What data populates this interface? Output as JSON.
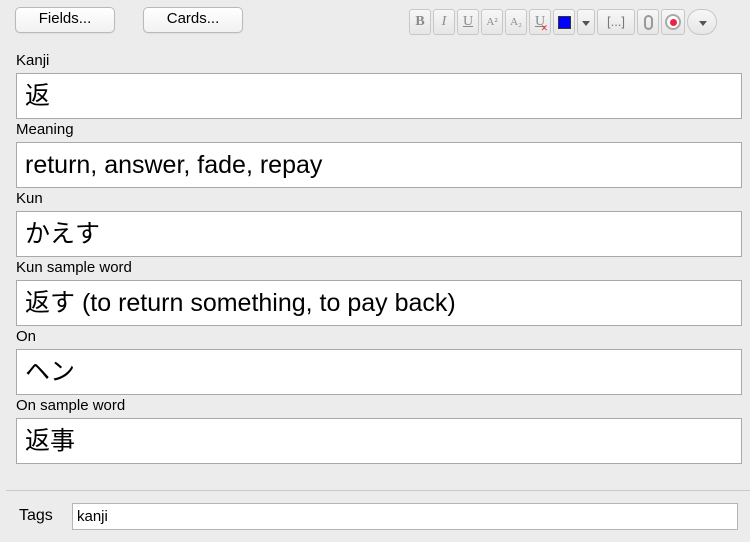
{
  "header": {
    "fields_button": "Fields...",
    "cards_button": "Cards..."
  },
  "toolbar": {
    "bold": "B",
    "italic": "I",
    "underline": "U",
    "superscript": "A²",
    "subscript": "A₂",
    "clear_format": "U",
    "text_color": "#0000ff",
    "cloze": "[...]",
    "icons": [
      "bold-icon",
      "italic-icon",
      "underline-icon",
      "superscript-icon",
      "subscript-icon",
      "clear-format-icon",
      "text-color-icon",
      "color-dropdown-icon",
      "cloze-icon",
      "attach-icon",
      "record-icon",
      "more-options-icon"
    ]
  },
  "fields": [
    {
      "label": "Kanji",
      "value": "返"
    },
    {
      "label": "Meaning",
      "value": "return, answer, fade, repay"
    },
    {
      "label": "Kun",
      "value": "かえす"
    },
    {
      "label": "Kun sample word",
      "value": "返す (to return something, to pay back)"
    },
    {
      "label": "On",
      "value": "ヘン"
    },
    {
      "label": "On sample word",
      "value": "返事"
    }
  ],
  "tags": {
    "label": "Tags",
    "value": "kanji"
  }
}
